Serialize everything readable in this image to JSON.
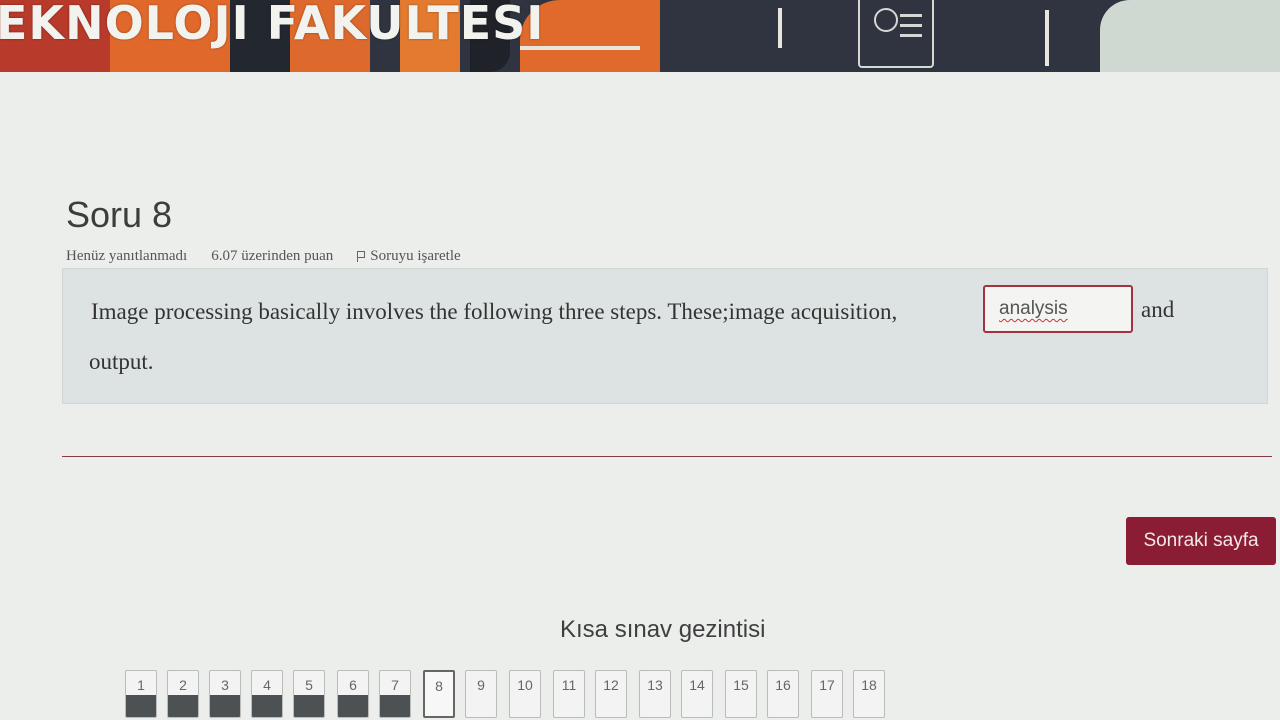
{
  "banner": {
    "title": "EKNOLOJI FAKULTESI",
    "colors": {
      "dark": "#2f3440",
      "orange": "#e0682a",
      "red": "#b83a2a"
    }
  },
  "question": {
    "title": "Soru 8",
    "status": "Henüz yanıtlanmadı",
    "points": "6.07 üzerinden puan",
    "flag_label": "Soruyu işaretle",
    "text_before": "Image processing basically involves the following three steps. These;image acquisition,",
    "answer_value": "analysis",
    "text_after_box": "and",
    "text_line2": "output."
  },
  "next_button": {
    "label": "Sonraki sayfa",
    "color": "#8a1d33"
  },
  "quiz_nav": {
    "title": "Kısa sınav gezintisi",
    "items": [
      {
        "label": "1",
        "state": "answered"
      },
      {
        "label": "2",
        "state": "answered"
      },
      {
        "label": "3",
        "state": "answered"
      },
      {
        "label": "4",
        "state": "answered"
      },
      {
        "label": "5",
        "state": "answered"
      },
      {
        "label": "6",
        "state": "answered"
      },
      {
        "label": "7",
        "state": "answered"
      },
      {
        "label": "8",
        "state": "current"
      },
      {
        "label": "9",
        "state": "empty"
      },
      {
        "label": "10",
        "state": "empty"
      },
      {
        "label": "11",
        "state": "empty"
      },
      {
        "label": "12",
        "state": "empty"
      },
      {
        "label": "13",
        "state": "empty"
      },
      {
        "label": "14",
        "state": "empty"
      },
      {
        "label": "15",
        "state": "empty"
      },
      {
        "label": "16",
        "state": "empty"
      },
      {
        "label": "17",
        "state": "empty"
      },
      {
        "label": "18",
        "state": "empty"
      }
    ]
  }
}
